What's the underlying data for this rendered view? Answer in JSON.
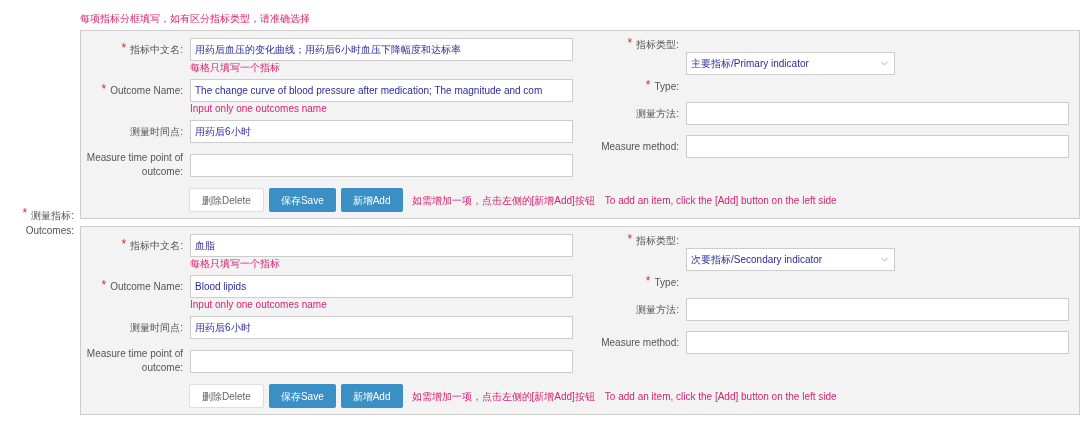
{
  "notice": "每项指标分框填写，如有区分指标类型，请准确选择",
  "outcomes_label": {
    "mark": "*",
    "zh": "测量指标:",
    "en": "Outcomes:"
  },
  "outcomes": [
    {
      "left_fields": [
        {
          "mark": "*",
          "label": "指标中文名:",
          "value": "用药后血压的变化曲线；用药后6小时血压下降幅度和达标率",
          "hint": "每格只填写一个指标"
        },
        {
          "mark": "*",
          "label": "Outcome Name:",
          "value": "The change curve of blood pressure after medication; The magnitude and com",
          "hint": "Input only one outcomes name"
        },
        {
          "label": "测量时间点:",
          "value": "用药后6小时"
        },
        {
          "label": "Measure time point of outcome:"
        }
      ],
      "type_labels": [
        {
          "mark": "*",
          "label": "指标类型:"
        },
        {
          "mark": "*",
          "label": "Type:"
        }
      ],
      "type_value": "主要指标/Primary indicator",
      "right_fields": [
        {
          "label": "测量方法:"
        },
        {
          "label": "Measure method:"
        }
      ],
      "buttons": [
        {
          "label": "删除Delete",
          "kind": "plain"
        },
        {
          "label": "保存Save",
          "kind": "primary"
        },
        {
          "label": "新增Add",
          "kind": "primary"
        }
      ],
      "tips": [
        "如需增加一项，点击左侧的[新增Add]按钮",
        "To add an item, click the [Add] button on the left side"
      ]
    },
    {
      "left_fields": [
        {
          "mark": "*",
          "label": "指标中文名:",
          "value": "血脂",
          "hint": "每格只填写一个指标"
        },
        {
          "mark": "*",
          "label": "Outcome Name:",
          "value": "Blood lipids",
          "hint": "Input only one outcomes name"
        },
        {
          "label": "测量时间点:",
          "value": "用药后6小时"
        },
        {
          "label": "Measure time point of outcome:"
        }
      ],
      "type_labels": [
        {
          "mark": "*",
          "label": "指标类型:"
        },
        {
          "mark": "*",
          "label": "Type:"
        }
      ],
      "type_value": "次要指标/Secondary indicator",
      "right_fields": [
        {
          "label": "测量方法:"
        },
        {
          "label": "Measure method:"
        }
      ],
      "buttons": [
        {
          "label": "删除Delete",
          "kind": "plain"
        },
        {
          "label": "保存Save",
          "kind": "primary"
        },
        {
          "label": "新增Add",
          "kind": "primary"
        }
      ],
      "tips": [
        "如需增加一项，点击左侧的[新增Add]按钮",
        "To add an item, click the [Add] button on the left side"
      ]
    }
  ]
}
